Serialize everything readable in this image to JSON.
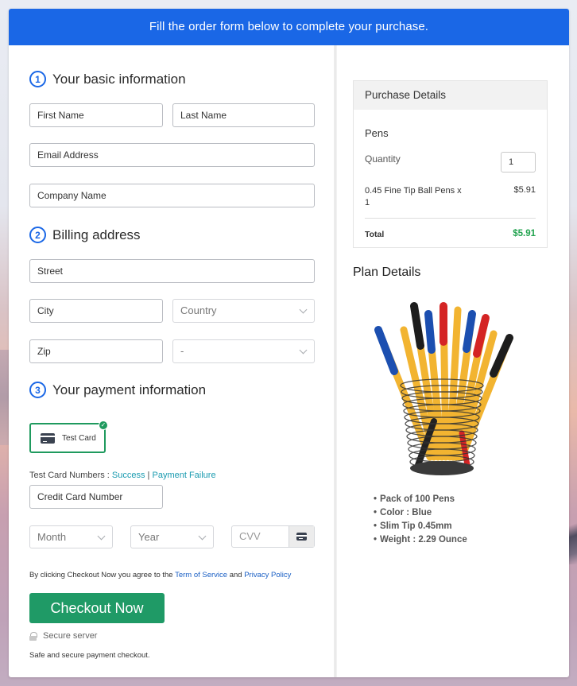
{
  "banner": {
    "text": "Fill the order form below to complete your purchase."
  },
  "sections": {
    "basic": {
      "number": "1",
      "title": "Your basic information"
    },
    "billing": {
      "number": "2",
      "title": "Billing address"
    },
    "payment": {
      "number": "3",
      "title": "Your payment information"
    }
  },
  "fields": {
    "first_name": "First Name",
    "last_name": "Last Name",
    "email": "Email Address",
    "company": "Company Name",
    "street": "Street",
    "city": "City",
    "country": "Country",
    "zip": "Zip",
    "state": "-",
    "card_number": "Credit Card Number",
    "month": "Month",
    "year": "Year",
    "cvv": "CVV"
  },
  "payment": {
    "method_label": "Test Card",
    "test_numbers_label": "Test Card Numbers : ",
    "success_link": "Success",
    "separator": " | ",
    "failure_link": "Payment Failure"
  },
  "agreement": {
    "prefix": "By clicking Checkout Now you agree to the ",
    "tos_link": "Term of Service",
    "and": " and ",
    "privacy_link": "Privacy Policy"
  },
  "checkout": {
    "button_label": "Checkout Now",
    "secure_label": "Secure server",
    "safe_text": "Safe and secure payment checkout."
  },
  "purchase": {
    "header": "Purchase Details",
    "product": "Pens",
    "quantity_label": "Quantity",
    "quantity_value": "1",
    "line_item": "0.45 Fine Tip Ball Pens x 1",
    "line_price": "$5.91",
    "total_label": "Total",
    "total_value": "$5.91"
  },
  "plan": {
    "title": "Plan Details",
    "image_icon": "pen-holder-image",
    "features": [
      "Pack of 100 Pens",
      "Color : Blue",
      "Slim Tip 0.45mm",
      "Weight  : 2.29 Ounce"
    ]
  },
  "colors": {
    "brand_blue": "#1a67e6",
    "checkout_green": "#1f9a66",
    "total_green": "#22a34f",
    "link_teal": "#1a9bb0"
  }
}
